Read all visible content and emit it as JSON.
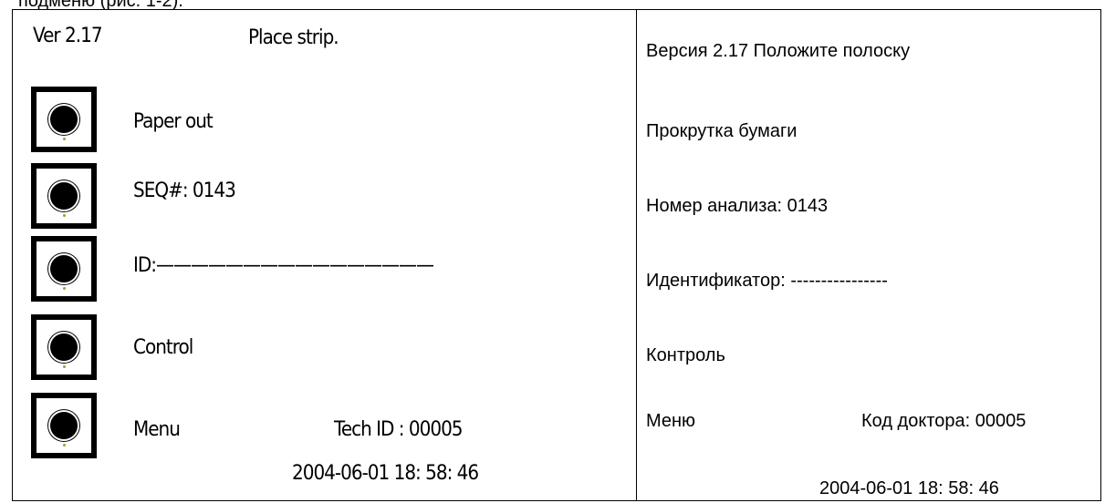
{
  "header_fragment": "подменю (рис. 1-2).",
  "screen": {
    "version": "Ver 2.17",
    "prompt": "Place strip.",
    "items": [
      {
        "label": "Paper out"
      },
      {
        "label": "SEQ#:  0143"
      },
      {
        "label": "ID:————————————————"
      },
      {
        "label": "Control"
      },
      {
        "label": "Menu"
      }
    ],
    "tech_id": "Tech ID : 00005",
    "datetime": "2004-06-01   18:  58:  46"
  },
  "translation": {
    "line1": "Версия 2.17 Положите полоску",
    "line2": "Прокрутка бумаги",
    "line3": "Номер анализа: 0143",
    "line4": "Идентификатор: ----------------",
    "line5": "Контроль",
    "menu": "Меню",
    "doctor_code": "Код доктора: 00005",
    "datetime": "2004-06-01     18: 58: 46"
  }
}
